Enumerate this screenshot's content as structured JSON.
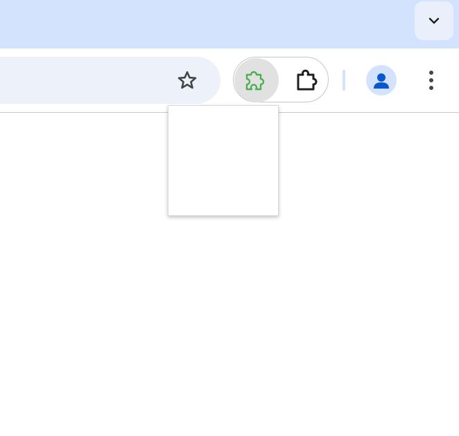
{
  "titlebar": {
    "tab_search_icon": "chevron-down-icon"
  },
  "toolbar": {
    "bookmark_icon": "star-outline-icon",
    "pinned_extension_icon": "puzzle-piece-icon",
    "pinned_extension_color": "#4caf50",
    "extensions_menu_icon": "extension-puzzle-icon",
    "profile_icon": "person-icon",
    "profile_color": "#0b57d0",
    "menu_icon": "vertical-dots-icon"
  },
  "popup": {
    "content": ""
  },
  "colors": {
    "titlebar_bg": "#d3e3fd",
    "omnibox_bg": "#edf2fa",
    "toolbar_bg": "#ffffff",
    "icon": "#444746"
  }
}
